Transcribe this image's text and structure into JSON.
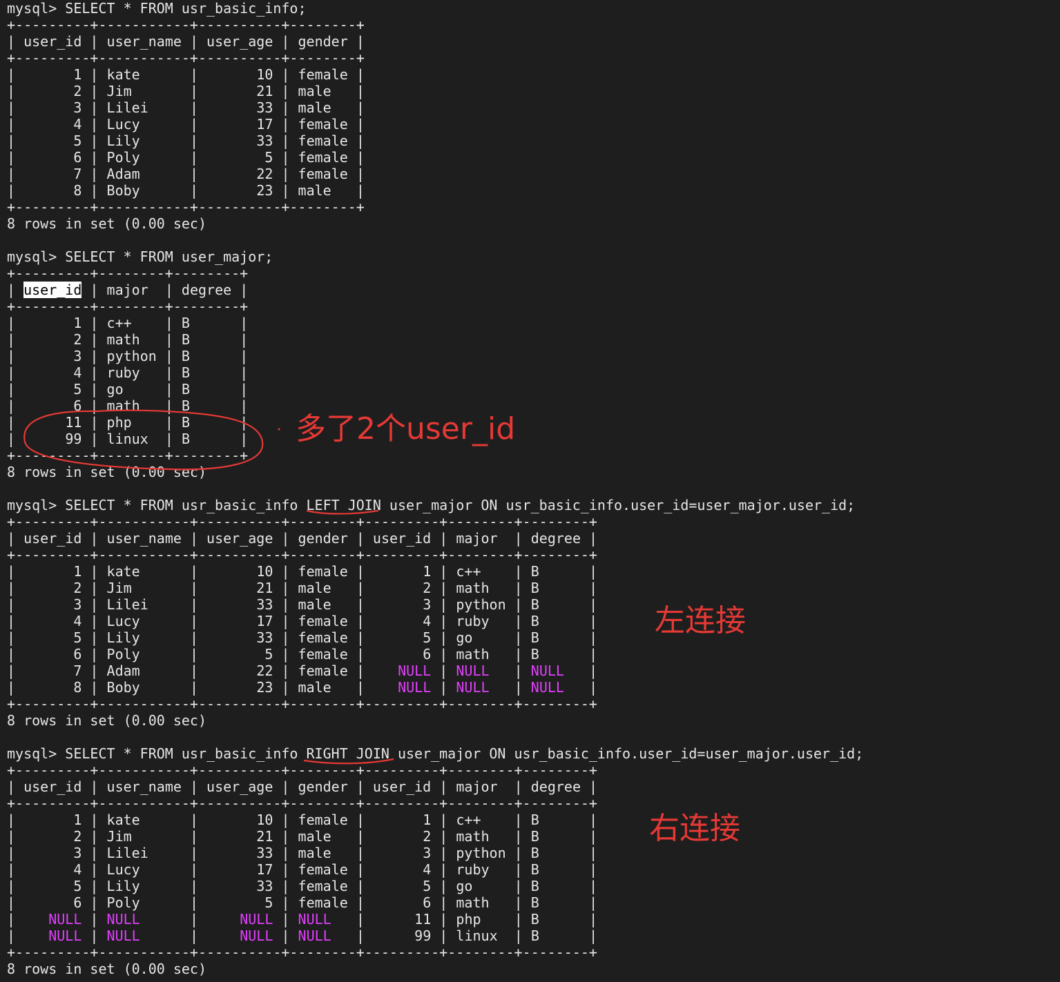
{
  "terminal": {
    "prompt": "mysql> ",
    "null_color": "#e040fb",
    "blocks": [
      {
        "command": "SELECT * FROM usr_basic_info;",
        "columns": [
          "user_id",
          "user_name",
          "user_age",
          "gender"
        ],
        "align": [
          "r",
          "l",
          "r",
          "l"
        ],
        "rows": [
          [
            "1",
            "kate",
            "10",
            "female"
          ],
          [
            "2",
            "Jim",
            "21",
            "male"
          ],
          [
            "3",
            "Lilei",
            "33",
            "male"
          ],
          [
            "4",
            "Lucy",
            "17",
            "female"
          ],
          [
            "5",
            "Lily",
            "33",
            "female"
          ],
          [
            "6",
            "Poly",
            "5",
            "female"
          ],
          [
            "7",
            "Adam",
            "22",
            "female"
          ],
          [
            "8",
            "Boby",
            "23",
            "male"
          ]
        ],
        "footer": "8 rows in set (0.00 sec)"
      },
      {
        "command": "SELECT * FROM user_major;",
        "columns": [
          "user_id",
          "major",
          "degree"
        ],
        "align": [
          "r",
          "l",
          "l"
        ],
        "rows": [
          [
            "1",
            "c++",
            "B"
          ],
          [
            "2",
            "math",
            "B"
          ],
          [
            "3",
            "python",
            "B"
          ],
          [
            "4",
            "ruby",
            "B"
          ],
          [
            "5",
            "go",
            "B"
          ],
          [
            "6",
            "math",
            "B"
          ],
          [
            "11",
            "php",
            "B"
          ],
          [
            "99",
            "linux",
            "B"
          ]
        ],
        "footer": "8 rows in set (0.00 sec)",
        "highlight_header": "user_id"
      },
      {
        "command": "SELECT * FROM usr_basic_info LEFT JOIN user_major ON usr_basic_info.user_id=user_major.user_id;",
        "columns": [
          "user_id",
          "user_name",
          "user_age",
          "gender",
          "user_id",
          "major",
          "degree"
        ],
        "align": [
          "r",
          "l",
          "r",
          "l",
          "r",
          "l",
          "l"
        ],
        "rows": [
          [
            "1",
            "kate",
            "10",
            "female",
            "1",
            "c++",
            "B"
          ],
          [
            "2",
            "Jim",
            "21",
            "male",
            "2",
            "math",
            "B"
          ],
          [
            "3",
            "Lilei",
            "33",
            "male",
            "3",
            "python",
            "B"
          ],
          [
            "4",
            "Lucy",
            "17",
            "female",
            "4",
            "ruby",
            "B"
          ],
          [
            "5",
            "Lily",
            "33",
            "female",
            "5",
            "go",
            "B"
          ],
          [
            "6",
            "Poly",
            "5",
            "female",
            "6",
            "math",
            "B"
          ],
          [
            "7",
            "Adam",
            "22",
            "female",
            "NULL",
            "NULL",
            "NULL"
          ],
          [
            "8",
            "Boby",
            "23",
            "male",
            "NULL",
            "NULL",
            "NULL"
          ]
        ],
        "footer": "8 rows in set (0.00 sec)"
      },
      {
        "command": "SELECT * FROM usr_basic_info RIGHT JOIN user_major ON usr_basic_info.user_id=user_major.user_id;",
        "columns": [
          "user_id",
          "user_name",
          "user_age",
          "gender",
          "user_id",
          "major",
          "degree"
        ],
        "align": [
          "r",
          "l",
          "r",
          "l",
          "r",
          "l",
          "l"
        ],
        "rows": [
          [
            "1",
            "kate",
            "10",
            "female",
            "1",
            "c++",
            "B"
          ],
          [
            "2",
            "Jim",
            "21",
            "male",
            "2",
            "math",
            "B"
          ],
          [
            "3",
            "Lilei",
            "33",
            "male",
            "3",
            "python",
            "B"
          ],
          [
            "4",
            "Lucy",
            "17",
            "female",
            "4",
            "ruby",
            "B"
          ],
          [
            "5",
            "Lily",
            "33",
            "female",
            "5",
            "go",
            "B"
          ],
          [
            "6",
            "Poly",
            "5",
            "female",
            "6",
            "math",
            "B"
          ],
          [
            "NULL",
            "NULL",
            "NULL",
            "NULL",
            "11",
            "php",
            "B"
          ],
          [
            "NULL",
            "NULL",
            "NULL",
            "NULL",
            "99",
            "linux",
            "B"
          ]
        ],
        "footer": "8 rows in set (0.00 sec)"
      }
    ]
  },
  "annotations": {
    "color": "#e53935",
    "extra_ids": "多了2个user_id",
    "left_join": "左连接",
    "right_join": "右连接"
  }
}
